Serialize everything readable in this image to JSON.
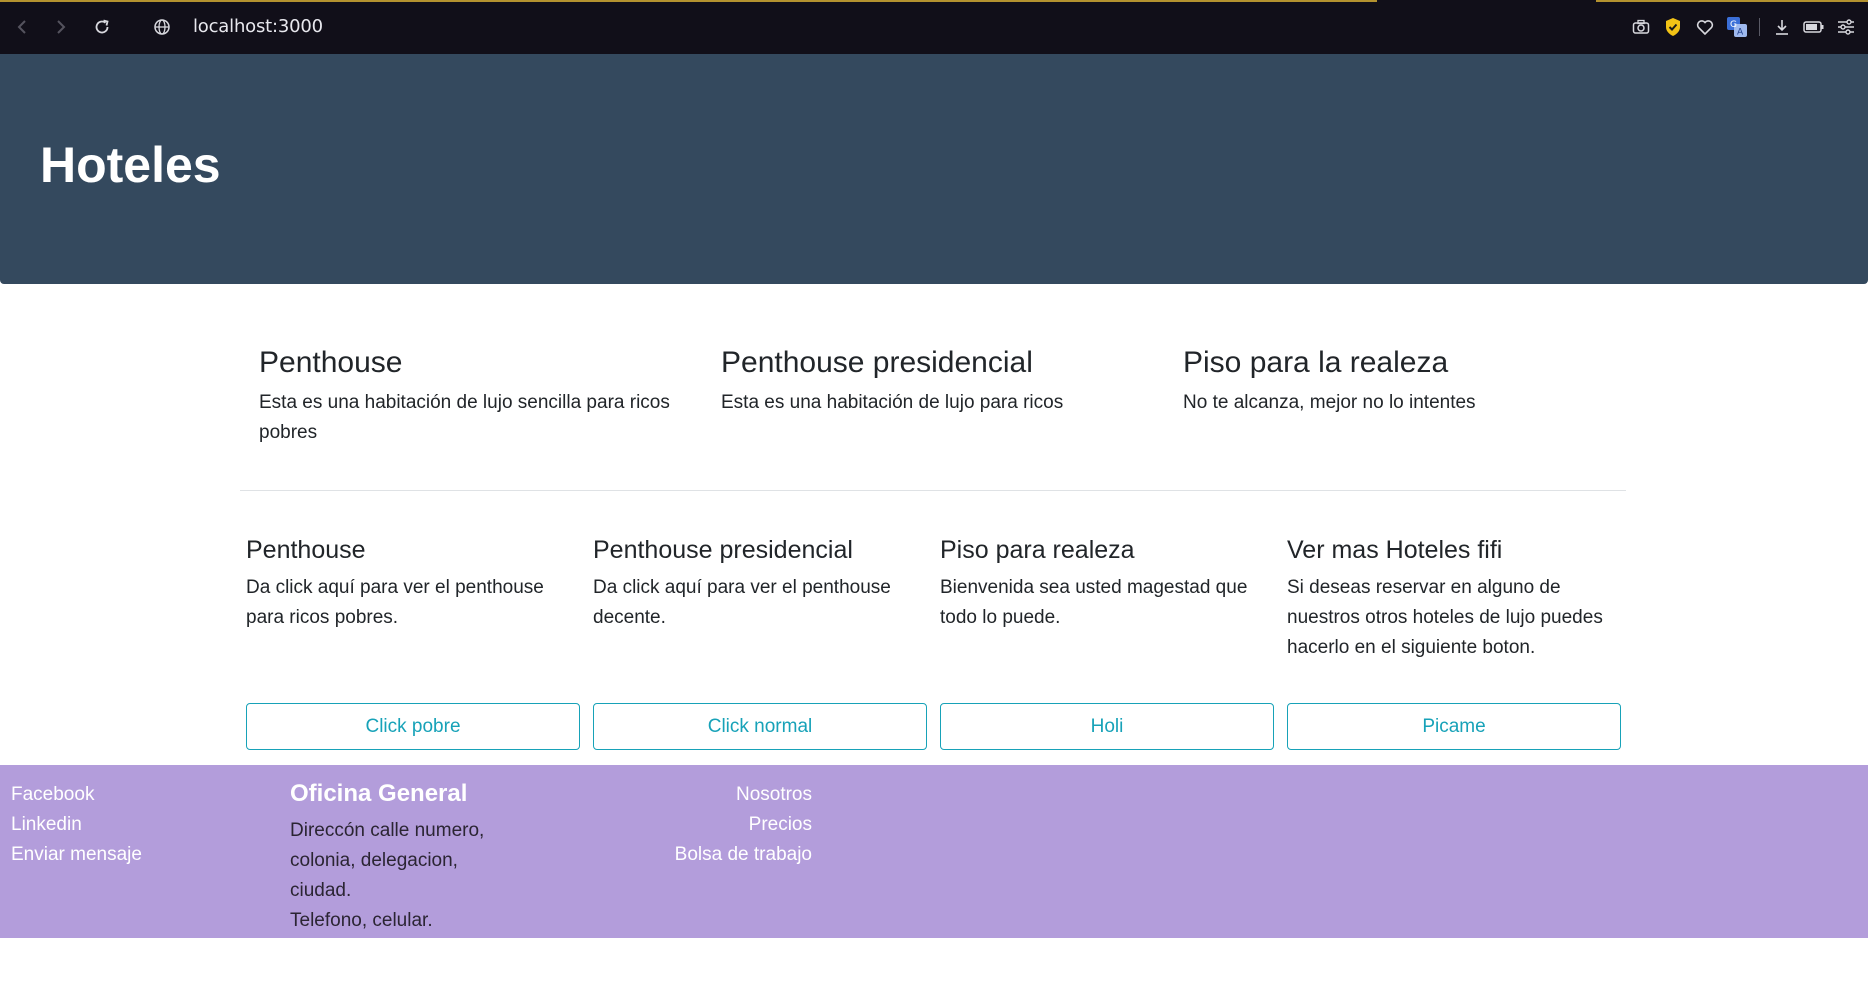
{
  "browser": {
    "url": "localhost:3000",
    "icons": [
      "back-icon",
      "forward-icon",
      "reload-icon",
      "site-info-icon",
      "camera-icon",
      "shield-icon",
      "heart-icon",
      "translate-icon",
      "download-icon",
      "battery-icon",
      "settings-icon"
    ]
  },
  "hero": {
    "title": "Hoteles"
  },
  "features": [
    {
      "title": "Penthouse",
      "text": "Esta es una habitación de lujo sencilla para ricos pobres"
    },
    {
      "title": "Penthouse presidencial",
      "text": "Esta es una habitación de lujo para ricos"
    },
    {
      "title": "Piso para la realeza",
      "text": "No te alcanza, mejor no lo intentes"
    }
  ],
  "cards": [
    {
      "title": "Penthouse",
      "text": "Da click aquí para ver el penthouse para ricos pobres.",
      "button": "Click pobre"
    },
    {
      "title": "Penthouse presidencial",
      "text": "Da click aquí para ver el penthouse decente.",
      "button": "Click normal"
    },
    {
      "title": "Piso para realeza",
      "text": "Bienvenida sea usted magestad que todo lo puede.",
      "button": "Holi"
    },
    {
      "title": "Ver mas Hoteles fifi",
      "text": "Si deseas reservar en alguno de nuestros otros hoteles de lujo puedes hacerlo en el siguiente boton.",
      "button": "Picame"
    }
  ],
  "footer": {
    "social": [
      "Facebook",
      "Linkedin",
      "Enviar mensaje"
    ],
    "office_title": "Oficina General",
    "office_address": "Direccón calle numero, colonia, delegacion, ciudad.",
    "office_phone": "Telefono, celular.",
    "links": [
      "Nosotros",
      "Precios",
      "Bolsa de trabajo"
    ]
  },
  "colors": {
    "hero_bg": "#34495e",
    "footer_bg": "#b39ddb",
    "button_accent": "#17a2b8",
    "browser_bg": "#110f19"
  }
}
